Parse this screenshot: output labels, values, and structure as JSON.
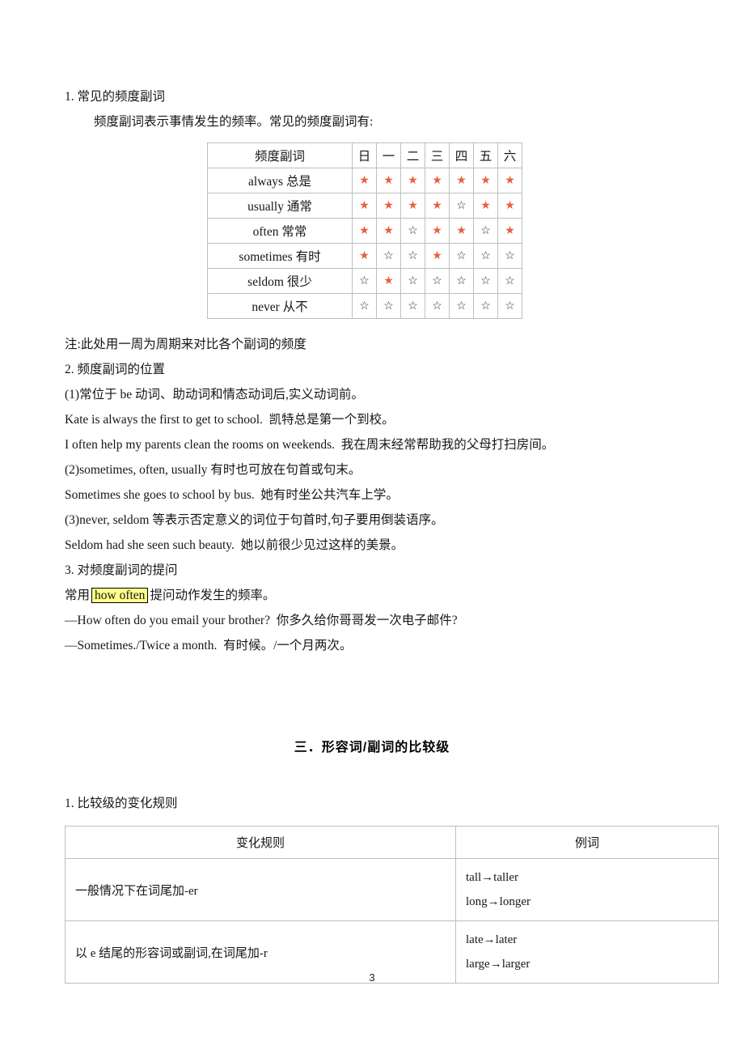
{
  "document": {
    "page_number": "3"
  },
  "section1": {
    "heading": "1. 常见的频度副词",
    "intro": "频度副词表示事情发生的频率。常见的频度副词有:",
    "note": "注:此处用一周为周期来对比各个副词的频度"
  },
  "freq_table": {
    "header": [
      "频度副词",
      "日",
      "一",
      "二",
      "三",
      "四",
      "五",
      "六"
    ],
    "rows": [
      {
        "adverb": "always  总是",
        "stars": [
          1,
          1,
          1,
          1,
          1,
          1,
          1
        ]
      },
      {
        "adverb": "usually  通常",
        "stars": [
          1,
          1,
          1,
          1,
          0,
          1,
          1
        ]
      },
      {
        "adverb": "often  常常",
        "stars": [
          1,
          1,
          0,
          1,
          1,
          0,
          1
        ]
      },
      {
        "adverb": "sometimes  有时",
        "stars": [
          1,
          0,
          0,
          1,
          0,
          0,
          0
        ]
      },
      {
        "adverb": "seldom  很少",
        "stars": [
          0,
          1,
          0,
          0,
          0,
          0,
          0
        ]
      },
      {
        "adverb": "never  从不",
        "stars": [
          0,
          0,
          0,
          0,
          0,
          0,
          0
        ]
      }
    ],
    "filled_glyph": "★",
    "empty_glyph": "☆",
    "filled_color": "#e8603f",
    "empty_color": "#2b2b2b"
  },
  "section2": {
    "heading": "2. 频度副词的位置",
    "lines": [
      "(1)常位于 be 动词、助动词和情态动词后,实义动词前。",
      "Kate is always the first to get to school.  凯特总是第一个到校。",
      "I often help my parents clean the rooms on weekends.  我在周末经常帮助我的父母打扫房间。",
      "(2)sometimes, often, usually 有时也可放在句首或句末。",
      "Sometimes she goes to school by bus.  她有时坐公共汽车上学。",
      "(3)never, seldom 等表示否定意义的词位于句首时,句子要用倒装语序。",
      "Seldom had she seen such beauty.  她以前很少见过这样的美景。"
    ]
  },
  "section3": {
    "heading": "3. 对频度副词的提问",
    "question_prefix": "常用",
    "highlight": "how often",
    "question_suffix": "提问动作发生的频率。",
    "qa": [
      "—How often do you email your brother?  你多久给你哥哥发一次电子邮件?",
      "—Sometimes./Twice a month.  有时候。/一个月两次。"
    ]
  },
  "chapter3": {
    "title": "三．形容词/副词的比较级",
    "subheading": "1. 比较级的变化规则"
  },
  "rules_table": {
    "header": [
      "变化规则",
      "例词"
    ],
    "rows": [
      {
        "rule": "一般情况下在词尾加-er",
        "examples": [
          "tall→taller",
          "long→longer"
        ]
      },
      {
        "rule": "以 e 结尾的形容词或副词,在词尾加-r",
        "examples": [
          "late→later",
          "large→larger"
        ]
      }
    ]
  }
}
